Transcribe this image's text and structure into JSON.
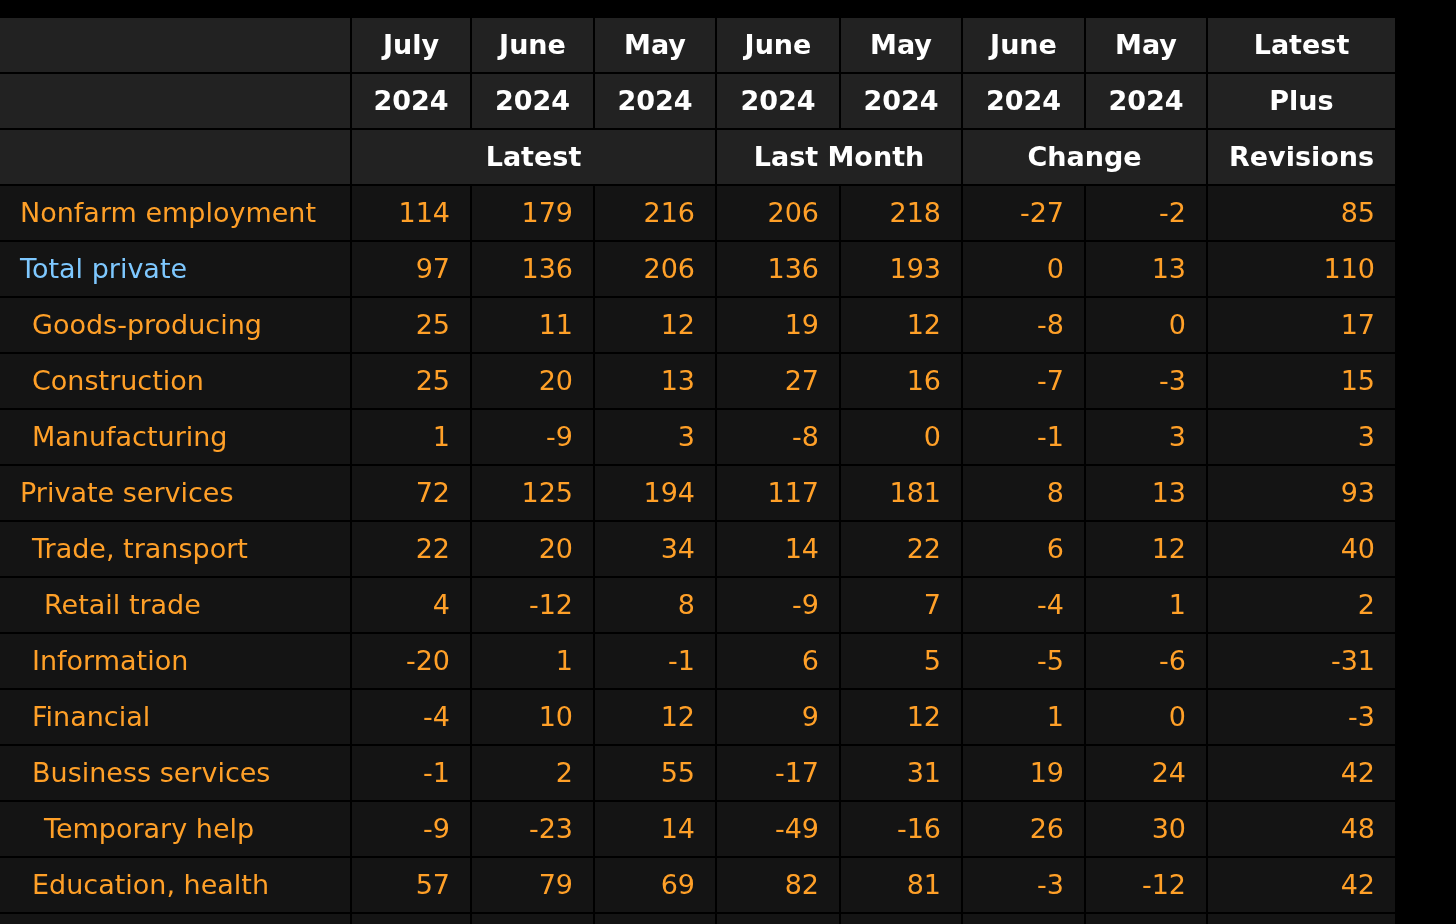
{
  "header": {
    "months": [
      "July",
      "June",
      "May",
      "June",
      "May",
      "June",
      "May",
      "Latest"
    ],
    "years": [
      "2024",
      "2024",
      "2024",
      "2024",
      "2024",
      "2024",
      "2024",
      "Plus"
    ],
    "groups": [
      {
        "label": "Latest"
      },
      {
        "label": "Last Month"
      },
      {
        "label": "Change"
      },
      {
        "label": "Revisions"
      }
    ]
  },
  "rows": [
    {
      "label": "Nonfarm employment",
      "color": "#ffa028",
      "values": [
        "114",
        "179",
        "216",
        "206",
        "218",
        "-27",
        "-2",
        "85"
      ]
    },
    {
      "label": "Total private",
      "color": "#7ec8ff",
      "values": [
        "97",
        "136",
        "206",
        "136",
        "193",
        "0",
        "13",
        "110"
      ],
      "children": [
        {
          "label": "Goods-producing",
          "color": "#ffa028",
          "values": [
            "25",
            "11",
            "12",
            "19",
            "12",
            "-8",
            "0",
            "17"
          ]
        },
        {
          "label": "Construction",
          "color": "#ffa028",
          "values": [
            "25",
            "20",
            "13",
            "27",
            "16",
            "-7",
            "-3",
            "15"
          ]
        },
        {
          "label": "Manufacturing",
          "color": "#ffa028",
          "values": [
            "1",
            "-9",
            "3",
            "-8",
            "0",
            "-1",
            "3",
            "3"
          ]
        }
      ]
    },
    {
      "label": "Private services",
      "color": "#ffa028",
      "values": [
        "72",
        "125",
        "194",
        "117",
        "181",
        "8",
        "13",
        "93"
      ],
      "children": [
        {
          "label": "Trade, transport",
          "color": "#ffa028",
          "values": [
            "22",
            "20",
            "34",
            "14",
            "22",
            "6",
            "12",
            "40"
          ],
          "children": [
            {
              "label": "Retail trade",
              "color": "#ffa028",
              "values": [
                "4",
                "-12",
                "8",
                "-9",
                "7",
                "-4",
                "1",
                "2"
              ]
            }
          ]
        },
        {
          "label": "Information",
          "color": "#ffa028",
          "values": [
            "-20",
            "1",
            "-1",
            "6",
            "5",
            "-5",
            "-6",
            "-31"
          ]
        },
        {
          "label": "Financial",
          "color": "#ffa028",
          "values": [
            "-4",
            "10",
            "12",
            "9",
            "12",
            "1",
            "0",
            "-3"
          ]
        },
        {
          "label": "Business services",
          "color": "#ffa028",
          "values": [
            "-1",
            "2",
            "55",
            "-17",
            "31",
            "19",
            "24",
            "42"
          ],
          "children": [
            {
              "label": "Temporary help",
              "color": "#ffa028",
              "values": [
                "-9",
                "-23",
                "14",
                "-49",
                "-16",
                "26",
                "30",
                "48"
              ]
            }
          ]
        },
        {
          "label": "Education, health",
          "color": "#ffa028",
          "values": [
            "57",
            "79",
            "69",
            "82",
            "81",
            "-3",
            "-12",
            "42"
          ]
        }
      ]
    }
  ]
}
